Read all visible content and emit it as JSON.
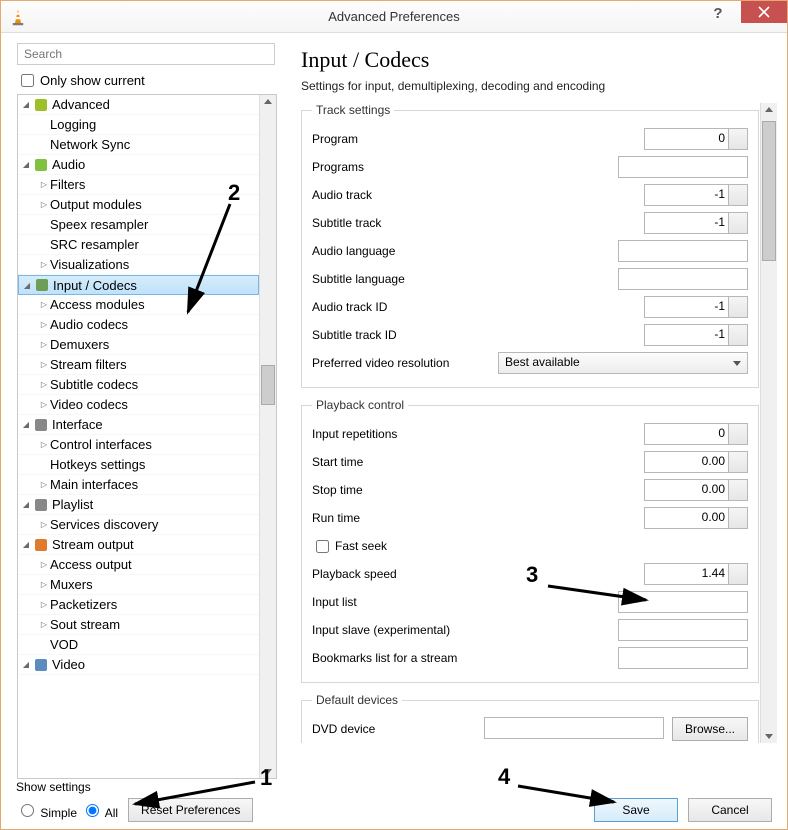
{
  "window": {
    "title": "Advanced Preferences"
  },
  "search": {
    "placeholder": "Search"
  },
  "only_show_current": "Only show current",
  "tree": [
    {
      "label": "Advanced",
      "depth": 0,
      "toggle": "expanded",
      "icon": "chip",
      "selected": false
    },
    {
      "label": "Logging",
      "depth": 1,
      "toggle": "none",
      "icon": "",
      "selected": false
    },
    {
      "label": "Network Sync",
      "depth": 1,
      "toggle": "none",
      "icon": "",
      "selected": false
    },
    {
      "label": "Audio",
      "depth": 0,
      "toggle": "expanded",
      "icon": "note",
      "selected": false
    },
    {
      "label": "Filters",
      "depth": 1,
      "toggle": "collapsed",
      "icon": "",
      "selected": false
    },
    {
      "label": "Output modules",
      "depth": 1,
      "toggle": "collapsed",
      "icon": "",
      "selected": false
    },
    {
      "label": "Speex resampler",
      "depth": 1,
      "toggle": "none",
      "icon": "",
      "selected": false
    },
    {
      "label": "SRC resampler",
      "depth": 1,
      "toggle": "none",
      "icon": "",
      "selected": false
    },
    {
      "label": "Visualizations",
      "depth": 1,
      "toggle": "collapsed",
      "icon": "",
      "selected": false
    },
    {
      "label": "Input / Codecs",
      "depth": 0,
      "toggle": "expanded",
      "icon": "codec",
      "selected": true
    },
    {
      "label": "Access modules",
      "depth": 1,
      "toggle": "collapsed",
      "icon": "",
      "selected": false
    },
    {
      "label": "Audio codecs",
      "depth": 1,
      "toggle": "collapsed",
      "icon": "",
      "selected": false
    },
    {
      "label": "Demuxers",
      "depth": 1,
      "toggle": "collapsed",
      "icon": "",
      "selected": false
    },
    {
      "label": "Stream filters",
      "depth": 1,
      "toggle": "collapsed",
      "icon": "",
      "selected": false
    },
    {
      "label": "Subtitle codecs",
      "depth": 1,
      "toggle": "collapsed",
      "icon": "",
      "selected": false
    },
    {
      "label": "Video codecs",
      "depth": 1,
      "toggle": "collapsed",
      "icon": "",
      "selected": false
    },
    {
      "label": "Interface",
      "depth": 0,
      "toggle": "expanded",
      "icon": "iface",
      "selected": false
    },
    {
      "label": "Control interfaces",
      "depth": 1,
      "toggle": "collapsed",
      "icon": "",
      "selected": false
    },
    {
      "label": "Hotkeys settings",
      "depth": 1,
      "toggle": "none",
      "icon": "",
      "selected": false
    },
    {
      "label": "Main interfaces",
      "depth": 1,
      "toggle": "collapsed",
      "icon": "",
      "selected": false
    },
    {
      "label": "Playlist",
      "depth": 0,
      "toggle": "expanded",
      "icon": "list",
      "selected": false
    },
    {
      "label": "Services discovery",
      "depth": 1,
      "toggle": "collapsed",
      "icon": "",
      "selected": false
    },
    {
      "label": "Stream output",
      "depth": 0,
      "toggle": "expanded",
      "icon": "sout",
      "selected": false
    },
    {
      "label": "Access output",
      "depth": 1,
      "toggle": "collapsed",
      "icon": "",
      "selected": false
    },
    {
      "label": "Muxers",
      "depth": 1,
      "toggle": "collapsed",
      "icon": "",
      "selected": false
    },
    {
      "label": "Packetizers",
      "depth": 1,
      "toggle": "collapsed",
      "icon": "",
      "selected": false
    },
    {
      "label": "Sout stream",
      "depth": 1,
      "toggle": "collapsed",
      "icon": "",
      "selected": false
    },
    {
      "label": "VOD",
      "depth": 1,
      "toggle": "none",
      "icon": "",
      "selected": false
    },
    {
      "label": "Video",
      "depth": 0,
      "toggle": "expanded",
      "icon": "video",
      "selected": false
    }
  ],
  "page": {
    "heading": "Input / Codecs",
    "sub": "Settings for input, demultiplexing, decoding and encoding"
  },
  "track": {
    "legend": "Track settings",
    "program": {
      "label": "Program",
      "value": "0"
    },
    "programs": {
      "label": "Programs",
      "value": ""
    },
    "audio_track": {
      "label": "Audio track",
      "value": "-1"
    },
    "subtitle_track": {
      "label": "Subtitle track",
      "value": "-1"
    },
    "audio_lang": {
      "label": "Audio language",
      "value": ""
    },
    "subtitle_lang": {
      "label": "Subtitle language",
      "value": ""
    },
    "audio_track_id": {
      "label": "Audio track ID",
      "value": "-1"
    },
    "subtitle_track_id": {
      "label": "Subtitle track ID",
      "value": "-1"
    },
    "pref_res": {
      "label": "Preferred video resolution",
      "value": "Best available"
    }
  },
  "playback": {
    "legend": "Playback control",
    "reps": {
      "label": "Input repetitions",
      "value": "0"
    },
    "start": {
      "label": "Start time",
      "value": "0.00"
    },
    "stop": {
      "label": "Stop time",
      "value": "0.00"
    },
    "run": {
      "label": "Run time",
      "value": "0.00"
    },
    "fast_seek": {
      "label": "Fast seek",
      "checked": false
    },
    "speed": {
      "label": "Playback speed",
      "value": "1.44"
    },
    "input_list": {
      "label": "Input list",
      "value": ""
    },
    "input_slave": {
      "label": "Input slave (experimental)",
      "value": ""
    },
    "bookmarks": {
      "label": "Bookmarks list for a stream",
      "value": ""
    }
  },
  "default_devices": {
    "legend": "Default devices",
    "dvd": {
      "label": "DVD device",
      "value": "",
      "browse": "Browse..."
    }
  },
  "footer": {
    "show_settings": "Show settings",
    "simple": "Simple",
    "all": "All",
    "reset": "Reset Preferences",
    "save": "Save",
    "cancel": "Cancel"
  },
  "annotations": {
    "a1": "1",
    "a2": "2",
    "a3": "3",
    "a4": "4"
  }
}
